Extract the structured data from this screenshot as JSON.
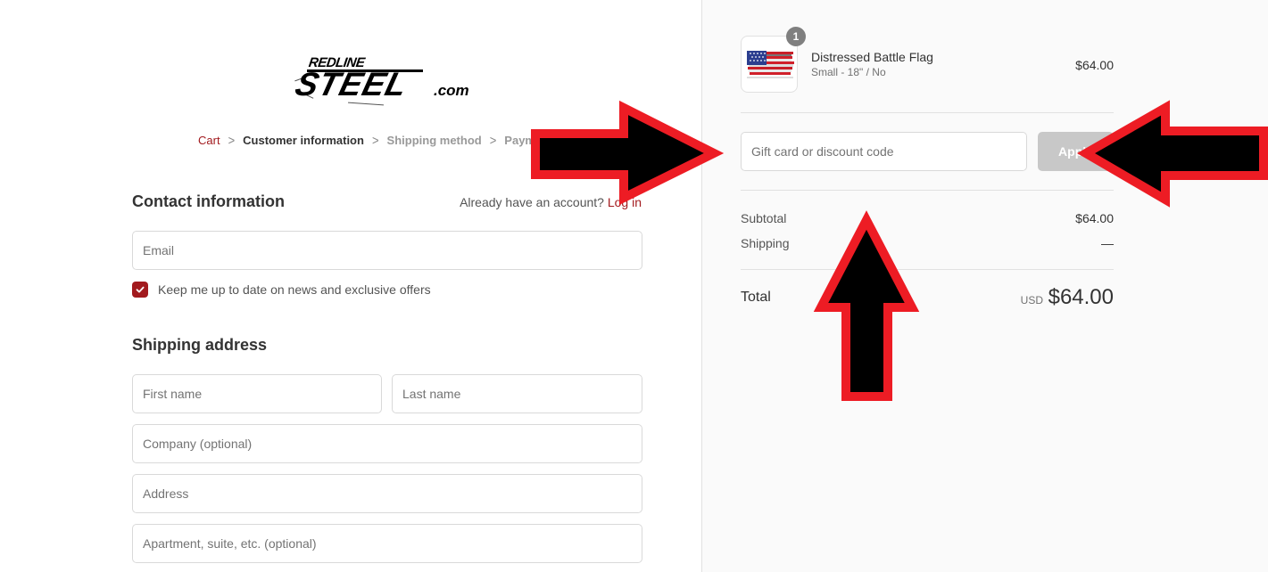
{
  "brand": {
    "logo_top": "REDLINE",
    "logo_main": "STEEL",
    "logo_suffix": ".com"
  },
  "breadcrumb": [
    {
      "label": "Cart",
      "state": "link"
    },
    {
      "label": "Customer information",
      "state": "current"
    },
    {
      "label": "Shipping method",
      "state": "disabled"
    },
    {
      "label": "Payment",
      "state": "disabled"
    }
  ],
  "breadcrumb_separator": ">",
  "contact": {
    "title": "Contact information",
    "account_prompt": "Already have an account?",
    "login_label": "Log in",
    "email_placeholder": "Email",
    "email_value": "",
    "newsletter_label": "Keep me up to date on news and exclusive offers",
    "newsletter_checked": true
  },
  "shipping": {
    "title": "Shipping address",
    "first_name_placeholder": "First name",
    "last_name_placeholder": "Last name",
    "company_placeholder": "Company (optional)",
    "address_placeholder": "Address",
    "apartment_placeholder": "Apartment, suite, etc. (optional)"
  },
  "order": {
    "item": {
      "name": "Distressed Battle Flag",
      "variant": "Small - 18\" / No",
      "price": "$64.00",
      "quantity": "1",
      "image": "flag-thumbnail-icon"
    },
    "discount_placeholder": "Gift card or discount code",
    "discount_value": "",
    "apply_label": "Apply",
    "subtotal_label": "Subtotal",
    "subtotal_value": "$64.00",
    "shipping_label": "Shipping",
    "shipping_value": "—",
    "total_label": "Total",
    "total_currency": "USD",
    "total_value": "$64.00"
  },
  "colors": {
    "accent": "#a21a1e",
    "apply_disabled": "#c8c8c8",
    "arrow_outline": "#ed1c24",
    "arrow_fill": "#000000"
  },
  "annotations": [
    {
      "type": "arrow",
      "direction": "right",
      "target": "discount-input"
    },
    {
      "type": "arrow",
      "direction": "left",
      "target": "apply-button"
    },
    {
      "type": "arrow",
      "direction": "up",
      "target": "discount-section"
    }
  ]
}
